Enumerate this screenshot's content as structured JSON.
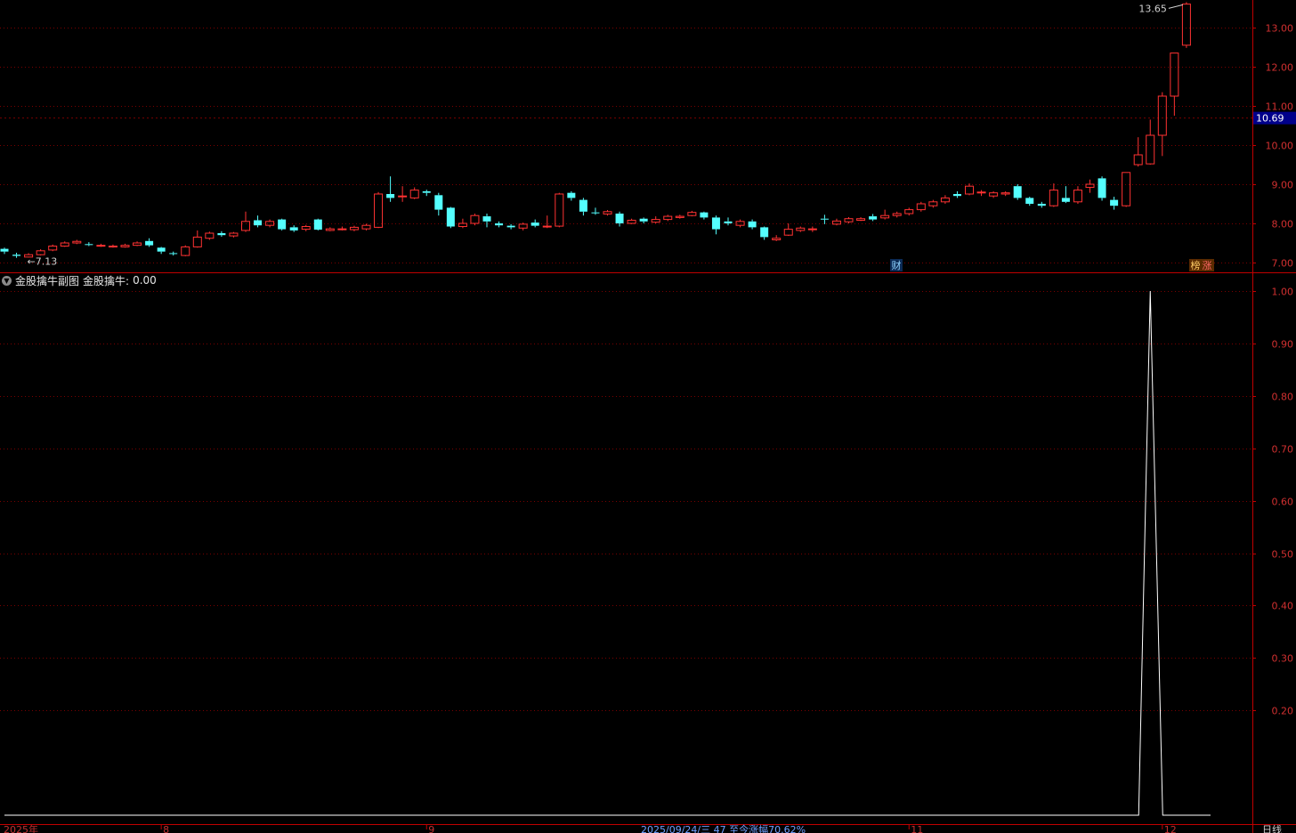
{
  "indicator": {
    "name": "金股擒牛副图",
    "series_label": "金股擒牛:",
    "series_value": "0.00"
  },
  "badges": {
    "fin": "财",
    "rank": "榜",
    "up": "涨"
  },
  "bottom": {
    "year_label": "2025年",
    "status_text": "2025/09/24/三 47 至今涨幅70.62%",
    "period_label": "日线"
  },
  "colors": {
    "up": "#ff3232",
    "down": "#54ffff",
    "grid": "#7a0000",
    "axis": "#c00000",
    "line": "#ffffff",
    "price_tag_bg": "#00008b"
  },
  "chart_data": [
    {
      "type": "candlestick",
      "y_ticks": [
        "7.00",
        "8.00",
        "9.00",
        "10.00",
        "11.00",
        "12.00",
        "13.00"
      ],
      "ylim": [
        6.85,
        13.75
      ],
      "current_price": "10.69",
      "max_label": "13.65",
      "min_label": "7.13",
      "x_month_labels": [
        "8",
        "9",
        "11",
        "12"
      ],
      "candles": [
        [
          7.35,
          7.28,
          7.38,
          7.22
        ],
        [
          7.2,
          7.17,
          7.25,
          7.12
        ],
        [
          7.14,
          7.2,
          7.24,
          7.13
        ],
        [
          7.2,
          7.3,
          7.34,
          7.18
        ],
        [
          7.32,
          7.42,
          7.46,
          7.29
        ],
        [
          7.42,
          7.5,
          7.54,
          7.4
        ],
        [
          7.5,
          7.54,
          7.58,
          7.47
        ],
        [
          7.47,
          7.45,
          7.52,
          7.42
        ],
        [
          7.44,
          7.44,
          7.48,
          7.4
        ],
        [
          7.4,
          7.42,
          7.46,
          7.38
        ],
        [
          7.4,
          7.44,
          7.48,
          7.38
        ],
        [
          7.44,
          7.5,
          7.54,
          7.42
        ],
        [
          7.55,
          7.44,
          7.62,
          7.4
        ],
        [
          7.38,
          7.28,
          7.4,
          7.22
        ],
        [
          7.24,
          7.22,
          7.28,
          7.18
        ],
        [
          7.18,
          7.4,
          7.44,
          7.16
        ],
        [
          7.4,
          7.65,
          7.82,
          7.38
        ],
        [
          7.62,
          7.75,
          7.79,
          7.58
        ],
        [
          7.75,
          7.7,
          7.8,
          7.66
        ],
        [
          7.68,
          7.75,
          7.78,
          7.64
        ],
        [
          7.82,
          8.05,
          8.3,
          7.78
        ],
        [
          8.08,
          7.95,
          8.2,
          7.9
        ],
        [
          7.95,
          8.05,
          8.1,
          7.9
        ],
        [
          8.1,
          7.85,
          8.12,
          7.82
        ],
        [
          7.9,
          7.82,
          7.95,
          7.78
        ],
        [
          7.85,
          7.92,
          7.96,
          7.8
        ],
        [
          8.1,
          7.84,
          8.12,
          7.82
        ],
        [
          7.82,
          7.86,
          7.9,
          7.8
        ],
        [
          7.86,
          7.86,
          7.92,
          7.82
        ],
        [
          7.84,
          7.9,
          7.94,
          7.8
        ],
        [
          7.86,
          7.95,
          7.99,
          7.82
        ],
        [
          7.9,
          8.75,
          8.8,
          7.88
        ],
        [
          8.75,
          8.65,
          9.2,
          8.55
        ],
        [
          8.7,
          8.7,
          8.95,
          8.55
        ],
        [
          8.65,
          8.85,
          8.92,
          8.62
        ],
        [
          8.82,
          8.78,
          8.86,
          8.7
        ],
        [
          8.72,
          8.35,
          8.78,
          8.2
        ],
        [
          8.4,
          7.92,
          8.42,
          7.88
        ],
        [
          7.92,
          8.0,
          8.12,
          7.88
        ],
        [
          8.0,
          8.2,
          8.25,
          7.95
        ],
        [
          8.18,
          8.05,
          8.25,
          7.9
        ],
        [
          8.0,
          7.95,
          8.05,
          7.9
        ],
        [
          7.94,
          7.9,
          7.98,
          7.85
        ],
        [
          7.88,
          7.98,
          8.02,
          7.82
        ],
        [
          8.02,
          7.94,
          8.1,
          7.9
        ],
        [
          7.92,
          7.93,
          8.2,
          7.88
        ],
        [
          7.93,
          8.75,
          8.78,
          7.9
        ],
        [
          8.78,
          8.65,
          8.82,
          8.58
        ],
        [
          8.6,
          8.3,
          8.65,
          8.2
        ],
        [
          8.28,
          8.26,
          8.4,
          8.22
        ],
        [
          8.24,
          8.3,
          8.34,
          8.2
        ],
        [
          8.25,
          8.0,
          8.3,
          7.92
        ],
        [
          8.0,
          8.08,
          8.12,
          7.98
        ],
        [
          8.12,
          8.05,
          8.15,
          8.0
        ],
        [
          8.03,
          8.1,
          8.18,
          8.0
        ],
        [
          8.1,
          8.18,
          8.22,
          8.06
        ],
        [
          8.15,
          8.18,
          8.22,
          8.12
        ],
        [
          8.2,
          8.28,
          8.32,
          8.18
        ],
        [
          8.28,
          8.15,
          8.3,
          8.1
        ],
        [
          8.15,
          7.85,
          8.2,
          7.72
        ],
        [
          8.05,
          8.0,
          8.15,
          7.95
        ],
        [
          7.95,
          8.05,
          8.1,
          7.9
        ],
        [
          8.05,
          7.9,
          8.1,
          7.85
        ],
        [
          7.9,
          7.65,
          7.92,
          7.58
        ],
        [
          7.58,
          7.62,
          7.7,
          7.55
        ],
        [
          7.7,
          7.85,
          8.0,
          7.68
        ],
        [
          7.82,
          7.88,
          7.92,
          7.78
        ],
        [
          7.86,
          7.86,
          7.92,
          7.78
        ],
        [
          8.12,
          8.1,
          8.22,
          7.98
        ],
        [
          7.98,
          8.06,
          8.12,
          7.95
        ],
        [
          8.04,
          8.12,
          8.16,
          8.0
        ],
        [
          8.08,
          8.12,
          8.16,
          8.06
        ],
        [
          8.18,
          8.1,
          8.24,
          8.06
        ],
        [
          8.14,
          8.2,
          8.35,
          8.1
        ],
        [
          8.2,
          8.25,
          8.3,
          8.15
        ],
        [
          8.25,
          8.35,
          8.4,
          8.2
        ],
        [
          8.35,
          8.5,
          8.55,
          8.3
        ],
        [
          8.45,
          8.55,
          8.6,
          8.4
        ],
        [
          8.55,
          8.65,
          8.72,
          8.5
        ],
        [
          8.75,
          8.7,
          8.82,
          8.65
        ],
        [
          8.75,
          8.95,
          9.02,
          8.72
        ],
        [
          8.8,
          8.8,
          8.85,
          8.7
        ],
        [
          8.7,
          8.78,
          8.82,
          8.65
        ],
        [
          8.75,
          8.78,
          8.82,
          8.7
        ],
        [
          8.95,
          8.65,
          9.0,
          8.6
        ],
        [
          8.65,
          8.5,
          8.68,
          8.45
        ],
        [
          8.5,
          8.45,
          8.55,
          8.4
        ],
        [
          8.45,
          8.85,
          9.02,
          8.42
        ],
        [
          8.65,
          8.55,
          8.95,
          8.52
        ],
        [
          8.55,
          8.85,
          8.95,
          8.5
        ],
        [
          8.92,
          9.0,
          9.12,
          8.78
        ],
        [
          9.15,
          8.65,
          9.2,
          8.58
        ],
        [
          8.6,
          8.45,
          8.68,
          8.35
        ],
        [
          8.45,
          9.3,
          9.3,
          8.42
        ],
        [
          9.5,
          9.75,
          10.2,
          9.45
        ],
        [
          9.52,
          10.25,
          10.65,
          9.5
        ],
        [
          10.25,
          11.25,
          11.35,
          9.72
        ],
        [
          11.25,
          12.35,
          12.35,
          10.75
        ],
        [
          12.55,
          13.6,
          13.65,
          12.48
        ]
      ]
    },
    {
      "type": "line",
      "name": "金股擒牛",
      "y_ticks": [
        "0.20",
        "0.30",
        "0.40",
        "0.50",
        "0.60",
        "0.70",
        "0.80",
        "0.90",
        "1.00"
      ],
      "ylim": [
        0,
        1.02
      ],
      "values": [
        0,
        0,
        0,
        0,
        0,
        0,
        0,
        0,
        0,
        0,
        0,
        0,
        0,
        0,
        0,
        0,
        0,
        0,
        0,
        0,
        0,
        0,
        0,
        0,
        0,
        0,
        0,
        0,
        0,
        0,
        0,
        0,
        0,
        0,
        0,
        0,
        0,
        0,
        0,
        0,
        0,
        0,
        0,
        0,
        0,
        0,
        0,
        0,
        0,
        0,
        0,
        0,
        0,
        0,
        0,
        0,
        0,
        0,
        0,
        0,
        0,
        0,
        0,
        0,
        0,
        0,
        0,
        0,
        0,
        0,
        0,
        0,
        0,
        0,
        0,
        0,
        0,
        0,
        0,
        0,
        0,
        0,
        0,
        0,
        0,
        0,
        0,
        0,
        0,
        0,
        0,
        0,
        0,
        0,
        0,
        1,
        0,
        0,
        0,
        0,
        0
      ]
    }
  ]
}
